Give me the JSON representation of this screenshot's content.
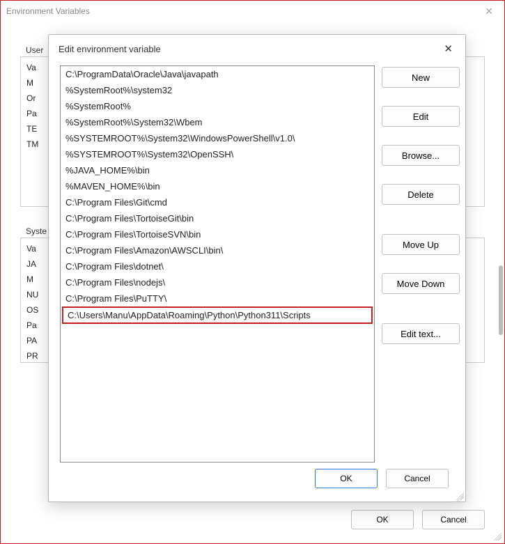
{
  "outer": {
    "title": "Environment Variables",
    "user_section_label": "User",
    "user_rows": [
      "Va",
      "M",
      "Or",
      "Pa",
      "TE",
      "TM"
    ],
    "sys_section_label": "Syste",
    "sys_rows": [
      "Va",
      "JA",
      "M",
      "NU",
      "OS",
      "Pa",
      "PA",
      "PR"
    ],
    "ok": "OK",
    "cancel": "Cancel"
  },
  "modal": {
    "title": "Edit environment variable",
    "paths": [
      "C:\\ProgramData\\Oracle\\Java\\javapath",
      "%SystemRoot%\\system32",
      "%SystemRoot%",
      "%SystemRoot%\\System32\\Wbem",
      "%SYSTEMROOT%\\System32\\WindowsPowerShell\\v1.0\\",
      "%SYSTEMROOT%\\System32\\OpenSSH\\",
      "%JAVA_HOME%\\bin",
      "%MAVEN_HOME%\\bin",
      "C:\\Program Files\\Git\\cmd",
      "C:\\Program Files\\TortoiseGit\\bin",
      "C:\\Program Files\\TortoiseSVN\\bin",
      "C:\\Program Files\\Amazon\\AWSCLI\\bin\\",
      "C:\\Program Files\\dotnet\\",
      "C:\\Program Files\\nodejs\\",
      "C:\\Program Files\\PuTTY\\",
      "C:\\Users\\Manu\\AppData\\Roaming\\Python\\Python311\\Scripts"
    ],
    "highlight_index": 15,
    "buttons": {
      "new": "New",
      "edit": "Edit",
      "browse": "Browse...",
      "delete": "Delete",
      "move_up": "Move Up",
      "move_down": "Move Down",
      "edit_text": "Edit text..."
    },
    "ok": "OK",
    "cancel": "Cancel"
  }
}
